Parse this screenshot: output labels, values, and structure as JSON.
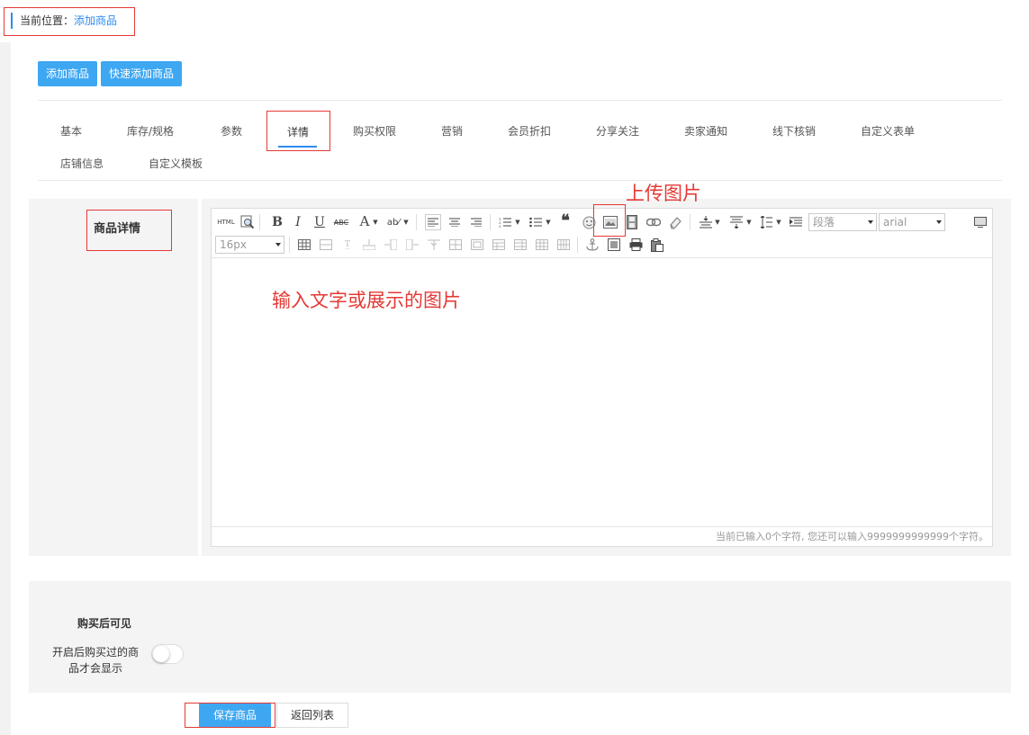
{
  "breadcrumb": {
    "label": "当前位置：",
    "current": "添加商品"
  },
  "top_buttons": {
    "add": "添加商品",
    "quick_add": "快速添加商品"
  },
  "tabs": [
    {
      "label": "基本"
    },
    {
      "label": "库存/规格"
    },
    {
      "label": "参数"
    },
    {
      "label": "详情",
      "active": true
    },
    {
      "label": "购买权限"
    },
    {
      "label": "营销"
    },
    {
      "label": "会员折扣"
    },
    {
      "label": "分享关注"
    },
    {
      "label": "卖家通知"
    },
    {
      "label": "线下核销"
    },
    {
      "label": "自定义表单"
    },
    {
      "label": "店铺信息"
    },
    {
      "label": "自定义模板"
    }
  ],
  "detail": {
    "label": "商品详情"
  },
  "editor": {
    "html_button": "HTML",
    "paragraph_select": "段落",
    "font_select": "arial",
    "size_select": "16px",
    "word_count": "当前已输入0个字符, 您还可以输入9999999999999个字符。",
    "icons": [
      "html-icon",
      "preview-icon",
      "bold-icon",
      "italic-icon",
      "underline-icon",
      "strikethrough-icon",
      "font-color-icon",
      "highlight-icon",
      "align-left-icon",
      "align-center-icon",
      "align-right-icon",
      "ordered-list-icon",
      "unordered-list-icon",
      "blockquote-icon",
      "emoticon-icon",
      "image-upload-icon",
      "video-icon",
      "link-icon",
      "eraser-icon",
      "row-spacing-top-icon",
      "row-spacing-bottom-icon",
      "line-height-icon",
      "indent-icon",
      "fullscreen-icon",
      "table-icon",
      "anchor-icon",
      "template-icon",
      "print-icon",
      "paste-icon"
    ]
  },
  "annotations": {
    "upload_image": "上传图片",
    "content_hint": "输入文字或展示的图片"
  },
  "purchase": {
    "title": "购买后可见",
    "desc_line1": "开启后购买过的商",
    "desc_line2": "品才会显示",
    "toggle_on": false
  },
  "actions": {
    "save": "保存商品",
    "back": "返回列表"
  },
  "colors": {
    "primary": "#3ea7f2",
    "accent_line": "#2d8cf0",
    "annotation": "#e53935"
  }
}
